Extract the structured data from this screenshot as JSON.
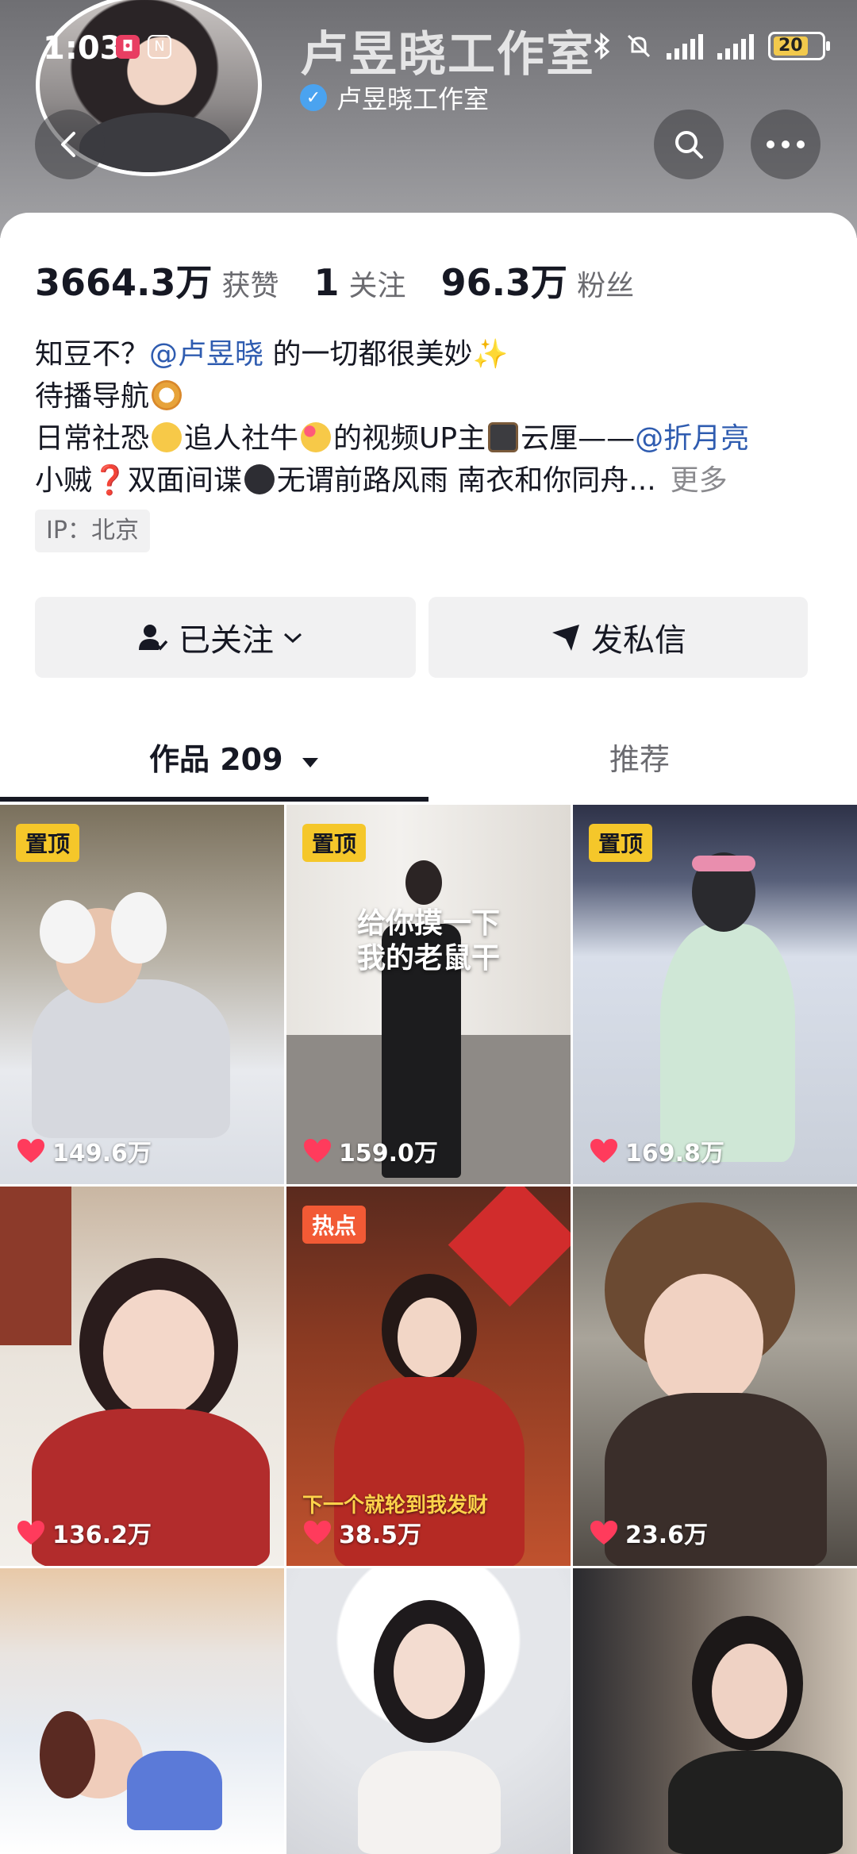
{
  "status_bar": {
    "time": "1:03",
    "battery": "20"
  },
  "header": {
    "title": "卢昱晓工作室",
    "verified_name": "卢昱晓工作室"
  },
  "stats": [
    {
      "value": "3664.3万",
      "label": "获赞"
    },
    {
      "value": "1",
      "label": "关注"
    },
    {
      "value": "96.3万",
      "label": "粉丝"
    }
  ],
  "bio": {
    "line1_prefix": "知豆不？",
    "line1_mention": "@卢昱晓",
    "line1_suffix": " 的一切都很美妙",
    "line2": "待播导航",
    "line3_a": "日常社恐",
    "line3_b": "追人社牛",
    "line3_c": "的视频UP主",
    "line3_d": "云厘——",
    "line3_mention": "@折月亮",
    "line4_a": "小贼",
    "line4_b": "双面间谍",
    "line4_c": "无谓前路风雨 南衣和你同舟...",
    "more": "更多"
  },
  "ip": "IP：北京",
  "buttons": {
    "follow": "已关注",
    "message": "发私信"
  },
  "tabs": {
    "works": "作品 209",
    "recommend": "推荐"
  },
  "videos": [
    {
      "badge": "置顶",
      "likes": "149.6万"
    },
    {
      "badge": "置顶",
      "likes": "159.0万",
      "overlay": "给你摸一下\n我的老鼠干"
    },
    {
      "badge": "置顶",
      "likes": "169.8万"
    },
    {
      "badge": "",
      "likes": "136.2万"
    },
    {
      "badge": "热点",
      "likes": "38.5万",
      "caption": "下一个就轮到我发财"
    },
    {
      "badge": "",
      "likes": "23.6万"
    },
    {
      "badge": "",
      "likes": ""
    },
    {
      "badge": "",
      "likes": ""
    },
    {
      "badge": "",
      "likes": ""
    }
  ],
  "colors": {
    "mention": "#2f5cb0",
    "pin_badge": "#f5c72a",
    "hot_badge": "#f25a35",
    "heart": "#ff3b5c"
  }
}
